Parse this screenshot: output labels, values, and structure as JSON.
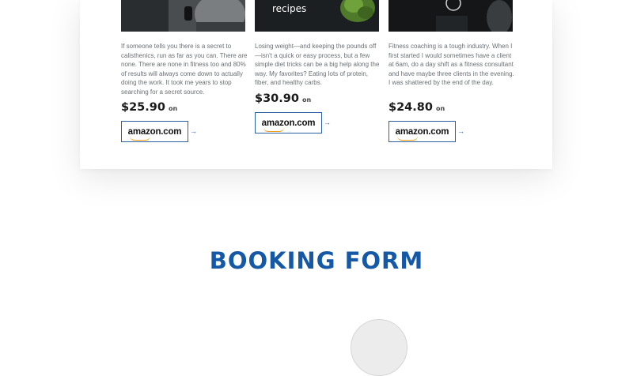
{
  "books": [
    {
      "image_caption": "",
      "description": "If someone tells you there is a secret to calisthenics, run as far as you can. There are none. There are none in fitness too and 80% of results will always come down to actually doing the work. It took me years to stop searching for a secret source.",
      "price": "$25.90",
      "on": "on",
      "store": "amazon.com"
    },
    {
      "image_caption": "recipes",
      "description": "Losing weight—and keeping the pounds off—isn't a quick or easy process, but a few simple diet tricks can be a big help along the way. My favorites? Eating lots of protein, fiber, and healthy carbs.",
      "price": "$30.90",
      "on": "on",
      "store": "amazon.com"
    },
    {
      "image_caption": "",
      "description": "Fitness coaching is a tough industry. When I first started I would sometimes have a client at 6am, do a day shift as a fitness consultant and have maybe three clients in the evening. I was shattered by the end of the day.",
      "price": "$24.80",
      "on": "on",
      "store": "amazon.com"
    }
  ],
  "booking": {
    "title": "BOOKING FORM"
  }
}
